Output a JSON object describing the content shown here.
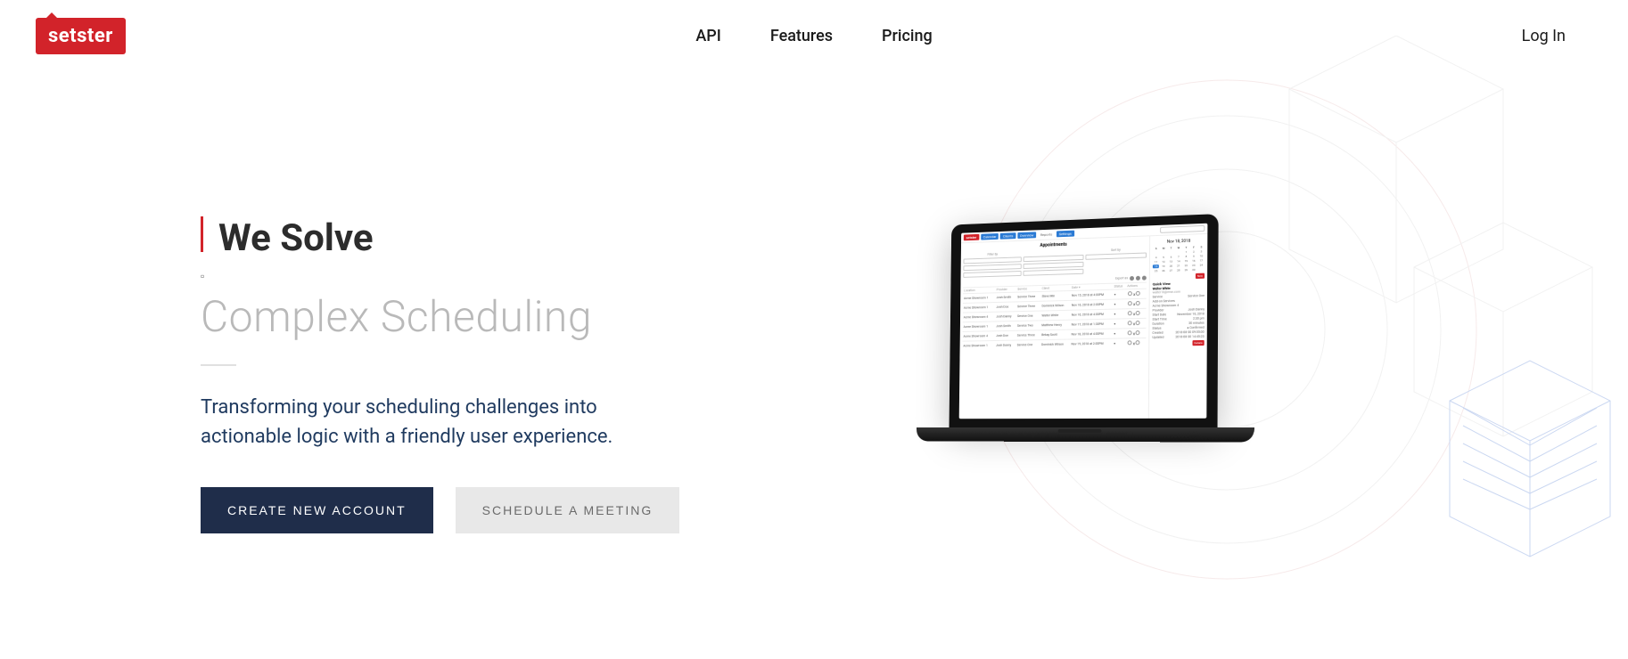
{
  "brand": "setster",
  "nav": {
    "links": [
      "API",
      "Features",
      "Pricing"
    ],
    "login": "Log In"
  },
  "hero": {
    "heading": "We Solve",
    "subheading": "Complex Scheduling",
    "body": "Transforming your scheduling challenges into actionable logic with a friendly user experience.",
    "cta_primary": "CREATE NEW ACCOUNT",
    "cta_secondary": "SCHEDULE A MEETING"
  },
  "laptop_app": {
    "tabs": [
      "Calendar",
      "Clients",
      "Overview",
      "Reports",
      "Settings"
    ],
    "search_placeholder": "Type to search...",
    "title": "Appointments",
    "filter_labels": [
      "Filter by",
      "",
      "Sort by"
    ],
    "filters": [
      "All Locations",
      "All Providers",
      "Appointment Date (Descending)",
      "All Services",
      "All Statuses",
      "",
      "Created",
      "Starts..."
    ],
    "export_label": "Export as",
    "table_headers": [
      "Location",
      "Provider",
      "Service",
      "Client",
      "Date ▾",
      "Status",
      "Actions"
    ],
    "rows": [
      [
        "Acme Showroom 1",
        "Josh Smith",
        "Service Three",
        "Steve Min",
        "Nov 15, 2018 at 4:00PM",
        "●"
      ],
      [
        "Acme Showroom 1",
        "Josh Doe",
        "Service Three",
        "Dominick Wilson",
        "Nov 16, 2018 at 2:00PM",
        "●"
      ],
      [
        "Acme Showroom 4",
        "Josh Danny",
        "Service One",
        "Walter White",
        "Nov 16, 2018 at 4:00PM",
        "●"
      ],
      [
        "Acme Showroom 1",
        "Josh Smith",
        "Service Two",
        "Matthew Henry",
        "Nov 17, 2018 at 1:30PM",
        "●"
      ],
      [
        "Acme Showroom 4",
        "Josh Doe",
        "Service Three",
        "Bekay Scott",
        "Nov 18, 2018 at 4:00PM",
        "●"
      ],
      [
        "Acme Showroom 1",
        "Josh Danny",
        "Service One",
        "Dominick Wilson",
        "Nov 19, 2018 at 2:00PM",
        "●"
      ]
    ],
    "calendar": {
      "title": "Nov 18, 2018",
      "days": [
        "Sun",
        "Mon",
        "Tue",
        "Wed",
        "Thu",
        "Fri",
        "Sat"
      ],
      "selected": 18
    },
    "quick_view": {
      "title": "Quick View",
      "name": "Walter White",
      "email": "walter18@msn.com",
      "fields": [
        [
          "Service",
          "Service One"
        ],
        [
          "Add-on Services",
          ""
        ],
        [
          "Acme Showroom 4",
          ""
        ],
        [
          "Provider",
          "Josh Danny"
        ],
        [
          "Start Date",
          "November 16, 2018"
        ],
        [
          "Start Time",
          "2:30 pm"
        ],
        [
          "Duration",
          "30 minutes"
        ],
        [
          "Status",
          "● Confirmed"
        ],
        [
          "Created",
          "2018-08-30 09:55:00"
        ],
        [
          "Updated",
          "2018-08-30 14:45:23"
        ]
      ],
      "button": "Details"
    }
  }
}
